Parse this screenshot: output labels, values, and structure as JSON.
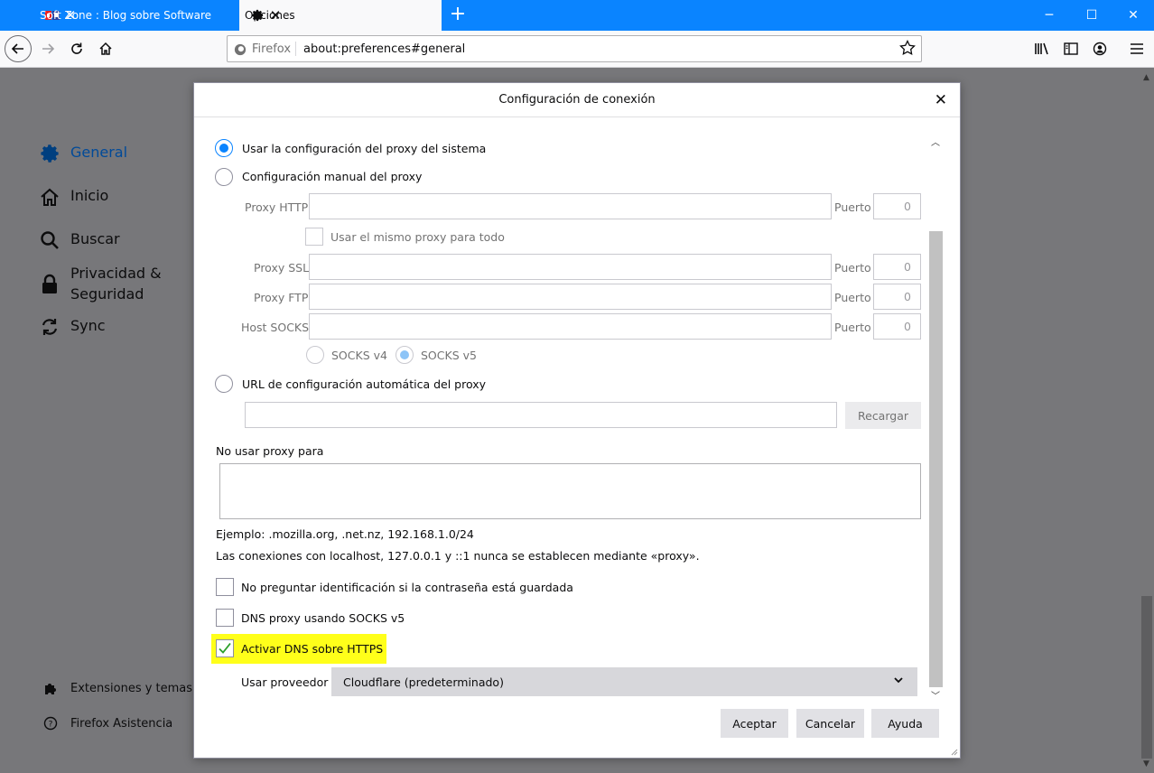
{
  "browser": {
    "tabs": [
      {
        "label": "Soft Zone : Blog sobre Software",
        "active": false
      },
      {
        "label": "Opciones",
        "active": true
      }
    ],
    "identity_label": "Firefox",
    "url": "about:preferences#general"
  },
  "sidebar": {
    "items": [
      {
        "label": "General",
        "icon": "gear-icon",
        "active": true
      },
      {
        "label": "Inicio",
        "icon": "home-icon"
      },
      {
        "label": "Buscar",
        "icon": "search-icon"
      },
      {
        "label": "Privacidad & Seguridad",
        "icon": "lock-icon"
      },
      {
        "label": "Sync",
        "icon": "sync-icon"
      }
    ],
    "footer": [
      {
        "label": "Extensiones y temas",
        "icon": "puzzle-icon"
      },
      {
        "label": "Firefox Asistencia",
        "icon": "help-icon"
      }
    ]
  },
  "dialog": {
    "title": "Configuración de conexión",
    "options": {
      "system": "Usar la configuración del proxy del sistema",
      "manual": "Configuración manual del proxy",
      "auto": "URL de configuración automática del proxy"
    },
    "selected_option": "system",
    "manual": {
      "http_label": "Proxy HTTP",
      "same_proxy": "Usar el mismo proxy para todo",
      "ssl_label": "Proxy SSL",
      "ftp_label": "Proxy FTP",
      "socks_label": "Host SOCKS",
      "port_label": "Puerto",
      "port_value": "0",
      "socks_v4": "SOCKS v4",
      "socks_v5": "SOCKS v5",
      "socks_selected": "SOCKS v5"
    },
    "reload_button": "Recargar",
    "no_proxy_label": "No usar proxy para",
    "example_text": "Ejemplo: .mozilla.org, .net.nz, 192.168.1.0/24",
    "localhost_text": "Las conexiones con localhost, 127.0.0.1 y ::1 nunca se establecen mediante «proxy».",
    "checkboxes": {
      "no_auth": {
        "label": "No preguntar identificación si la contraseña está guardada",
        "checked": false
      },
      "dns_socks": {
        "label": "DNS proxy usando SOCKS v5",
        "checked": false
      },
      "doh": {
        "label": "Activar DNS sobre HTTPS",
        "checked": true
      }
    },
    "provider_label": "Usar proveedor",
    "provider_value": "Cloudflare (predeterminado)",
    "buttons": {
      "accept": "Aceptar",
      "cancel": "Cancelar",
      "help": "Ayuda"
    },
    "highlight_color": "#ffff1a",
    "accent_color": "#0a84ff"
  }
}
